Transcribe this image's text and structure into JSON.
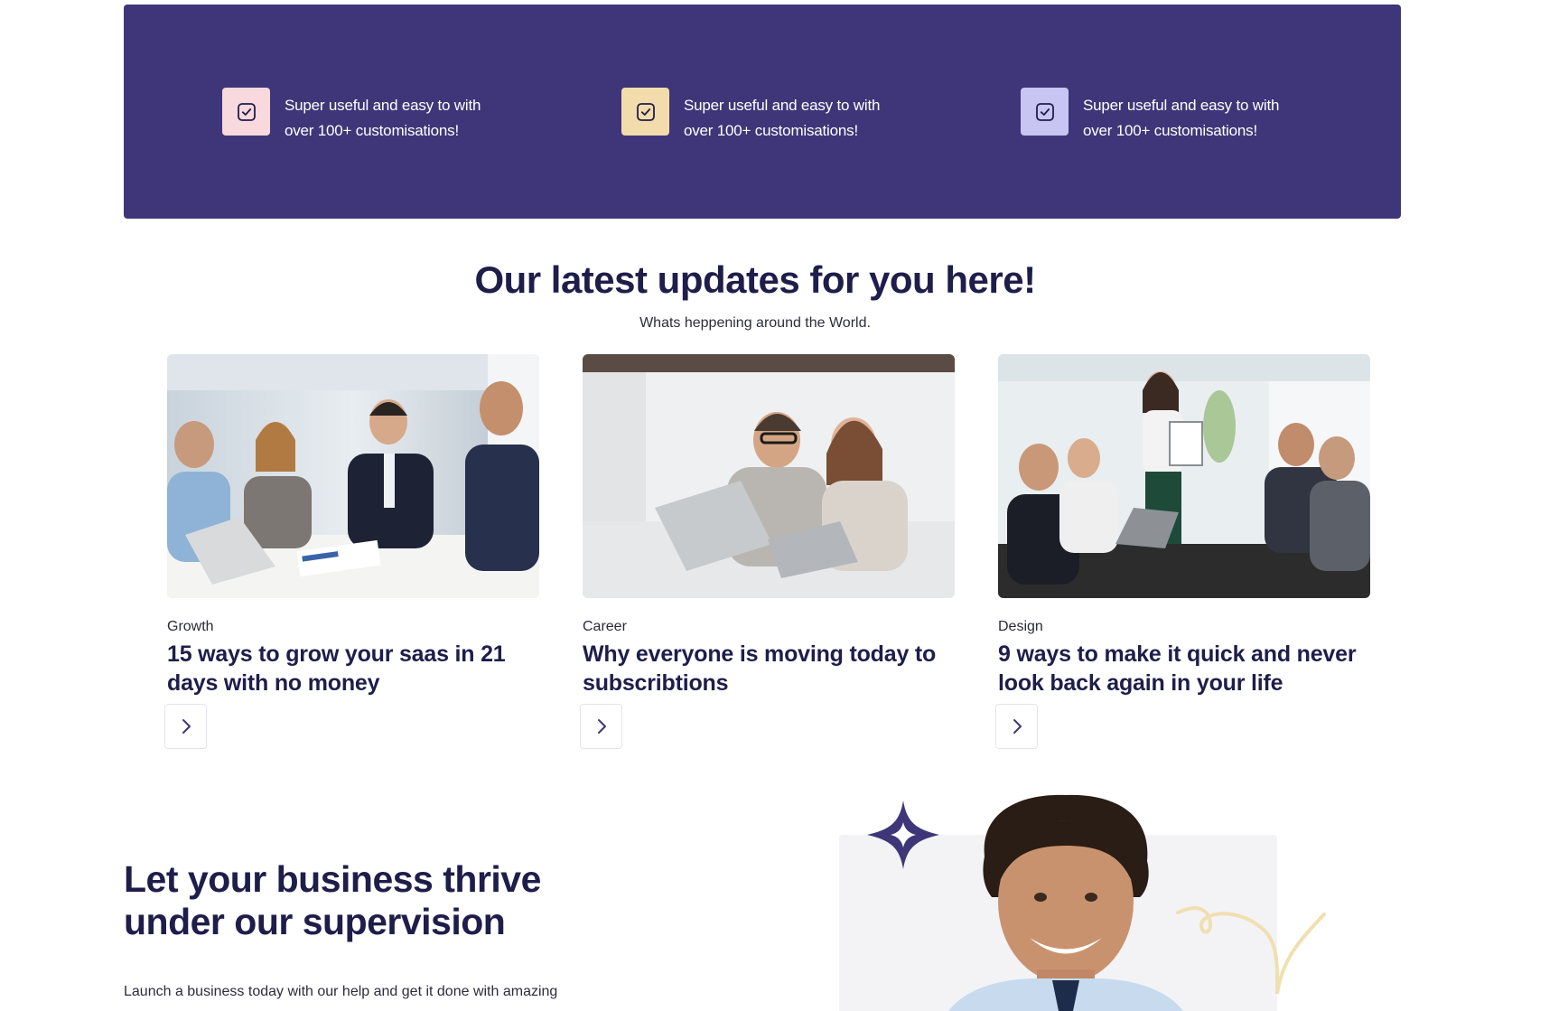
{
  "banner": {
    "features": [
      {
        "line1": "Super useful and easy to with",
        "line2": "over 100+ customisations!",
        "icon": "check-square-icon",
        "bg": "#f8d9dd"
      },
      {
        "line1": "Super useful and easy to with",
        "line2": "over 100+ customisations!",
        "icon": "check-square-icon",
        "bg": "#f3dcac"
      },
      {
        "line1": "Super useful and easy to with",
        "line2": "over 100+ customisations!",
        "icon": "check-square-icon",
        "bg": "#c9c5f3"
      }
    ]
  },
  "updates": {
    "title": "Our latest updates for you here!",
    "subtitle": "Whats heppening around the World.",
    "cards": [
      {
        "category": "Growth",
        "title_line1": "15 ways to grow your saas in 21",
        "title_line2": "days with no money",
        "arrow_icon": "chevron-right-icon"
      },
      {
        "category": "Career",
        "title_line1": "Why everyone is moving today to",
        "title_line2": "subscribtions",
        "arrow_icon": "chevron-right-icon"
      },
      {
        "category": "Design",
        "title_line1": "9 ways to make it quick and never",
        "title_line2": "look back again in your life",
        "arrow_icon": "chevron-right-icon"
      }
    ]
  },
  "cta": {
    "title_line1": "Let your business thrive",
    "title_line2": "under our supervision",
    "text": "Launch a business today with our help and get it done with amazing"
  },
  "colors": {
    "banner_bg": "#3e3678",
    "heading": "#1f1d4a",
    "accent_star": "#3e3678",
    "scribble": "#f0dfb0"
  }
}
